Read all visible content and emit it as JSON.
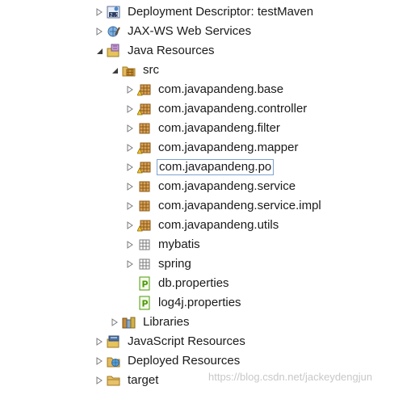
{
  "tree": {
    "items": [
      {
        "label": "Deployment Descriptor: testMaven",
        "icon": "deployment-descriptor-icon",
        "expanded": false
      },
      {
        "label": "JAX-WS Web Services",
        "icon": "web-services-icon",
        "expanded": false
      },
      {
        "label": "Java Resources",
        "icon": "java-resources-icon",
        "expanded": true
      },
      {
        "label": "src",
        "icon": "source-folder-icon",
        "expanded": true
      },
      {
        "label": "com.javapandeng.base",
        "icon": "package-icon",
        "expanded": false
      },
      {
        "label": "com.javapandeng.controller",
        "icon": "package-icon",
        "expanded": false
      },
      {
        "label": "com.javapandeng.filter",
        "icon": "package-icon",
        "expanded": false
      },
      {
        "label": "com.javapandeng.mapper",
        "icon": "package-icon",
        "expanded": false
      },
      {
        "label": "com.javapandeng.po",
        "icon": "package-icon",
        "expanded": false,
        "selected": true
      },
      {
        "label": "com.javapandeng.service",
        "icon": "package-icon",
        "expanded": false
      },
      {
        "label": "com.javapandeng.service.impl",
        "icon": "package-icon",
        "expanded": false
      },
      {
        "label": "com.javapandeng.utils",
        "icon": "package-icon",
        "expanded": false
      },
      {
        "label": "mybatis",
        "icon": "resource-folder-icon",
        "expanded": false
      },
      {
        "label": "spring",
        "icon": "resource-folder-icon",
        "expanded": false
      },
      {
        "label": "db.properties",
        "icon": "properties-file-icon"
      },
      {
        "label": "log4j.properties",
        "icon": "properties-file-icon"
      },
      {
        "label": "Libraries",
        "icon": "libraries-icon",
        "expanded": false
      },
      {
        "label": "JavaScript Resources",
        "icon": "javascript-resources-icon",
        "expanded": false
      },
      {
        "label": "Deployed Resources",
        "icon": "deployed-resources-icon",
        "expanded": false
      },
      {
        "label": "target",
        "icon": "folder-icon",
        "expanded": false
      }
    ]
  },
  "watermark": "https://blog.csdn.net/jackeydengjun",
  "colors": {
    "selection_border": "#7da2ce",
    "package_brown": "#b5651d",
    "warning_yellow": "#f2c12e",
    "properties_green": "#4e9a06"
  }
}
